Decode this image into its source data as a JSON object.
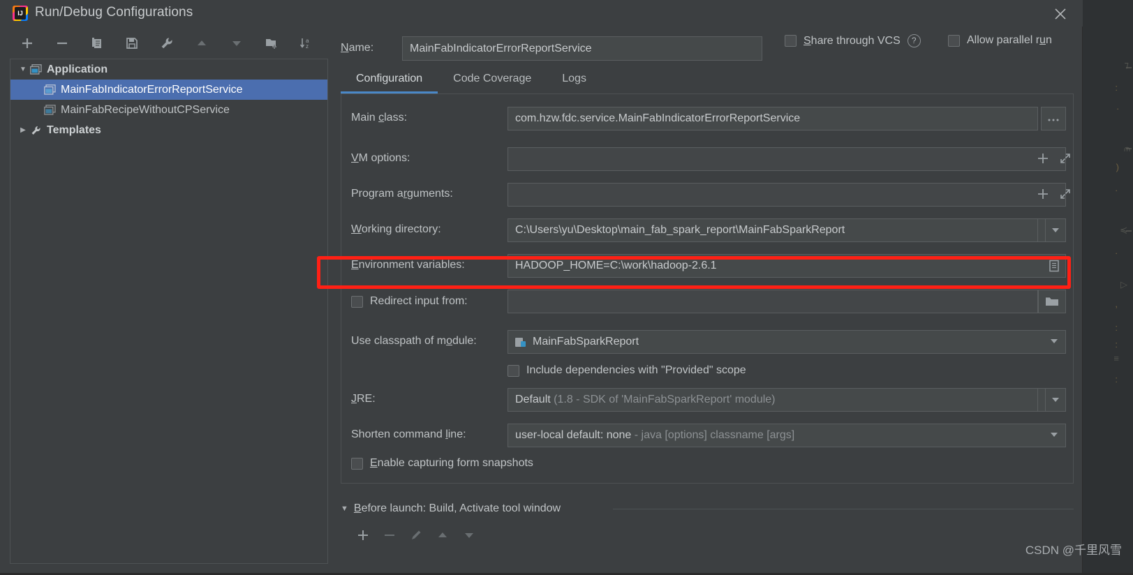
{
  "window": {
    "title": "Run/Debug Configurations",
    "logo_icon": "intellij-idea-logo-icon",
    "close_icon": "close-icon"
  },
  "left_panel": {
    "toolbar": [
      {
        "name": "add-configuration-button",
        "icon": "plus-icon",
        "label": "+",
        "enabled": true
      },
      {
        "name": "remove-configuration-button",
        "icon": "minus-icon",
        "label": "−",
        "enabled": true
      },
      {
        "name": "copy-configuration-button",
        "icon": "copy-icon",
        "label": "Copy",
        "enabled": true
      },
      {
        "name": "save-configuration-button",
        "icon": "save-icon",
        "label": "Save",
        "enabled": true
      },
      {
        "name": "edit-templates-button",
        "icon": "wrench-icon",
        "label": "Edit Templates",
        "enabled": true
      },
      {
        "name": "move-up-button",
        "icon": "arrow-up-icon",
        "label": "Move Up",
        "enabled": false
      },
      {
        "name": "move-down-button",
        "icon": "arrow-down-icon",
        "label": "Move Down",
        "enabled": false
      },
      {
        "name": "new-folder-button",
        "icon": "new-folder-icon",
        "label": "New Folder",
        "enabled": true
      },
      {
        "name": "sort-alphabetically-button",
        "icon": "sort-az-icon",
        "label": "Sort Configurations",
        "enabled": true
      }
    ],
    "tree": [
      {
        "label": "Application",
        "level": 0,
        "expanded": true,
        "icon": "application-icon",
        "selected": false,
        "bold": true
      },
      {
        "label": "MainFabIndicatorErrorReportService",
        "level": 1,
        "expanded": null,
        "icon": "application-icon",
        "selected": true,
        "bold": false
      },
      {
        "label": "MainFabRecipeWithoutCPService",
        "level": 1,
        "expanded": null,
        "icon": "application-icon",
        "selected": false,
        "bold": false
      },
      {
        "label": "Templates",
        "level": 0,
        "expanded": false,
        "icon": "wrench-icon",
        "selected": false,
        "bold": true
      }
    ]
  },
  "header": {
    "name_label": "Name:",
    "name_value": "MainFabIndicatorErrorReportService",
    "share_vcs_label": "Share through VCS",
    "share_vcs_checked": false,
    "help_icon": "help-circle-icon",
    "allow_parallel_label": "Allow parallel run",
    "allow_parallel_checked": false
  },
  "tabs": [
    {
      "label": "Configuration",
      "active": true
    },
    {
      "label": "Code Coverage",
      "active": false
    },
    {
      "label": "Logs",
      "active": false
    }
  ],
  "form": {
    "main_class": {
      "label": "Main class:",
      "value": "com.hzw.fdc.service.MainFabIndicatorErrorReportService",
      "browse_label": "...",
      "browse_icon": "ellipsis-icon"
    },
    "vm_options": {
      "label": "VM options:",
      "value": "",
      "macro_icon": "plus-icon",
      "expand_icon": "expand-icon"
    },
    "program_arguments": {
      "label": "Program arguments:",
      "value": "",
      "macro_icon": "plus-icon",
      "expand_icon": "expand-icon"
    },
    "working_directory": {
      "label": "Working directory:",
      "value": "C:\\Users\\yu\\Desktop\\main_fab_spark_report\\MainFabSparkReport",
      "browse_icon": "folder-icon",
      "dropdown_icon": "chevron-down-icon"
    },
    "environment_variables": {
      "label": "Environment variables:",
      "value": "HADOOP_HOME=C:\\work\\hadoop-2.6.1",
      "browse_icon": "document-list-icon",
      "highlighted": true
    },
    "redirect_input": {
      "label": "Redirect input from:",
      "checked": false,
      "value": "",
      "browse_icon": "folder-icon"
    },
    "use_classpath_of_module": {
      "label": "Use classpath of module:",
      "value": "MainFabSparkReport",
      "item_icon": "module-icon",
      "dropdown_icon": "chevron-down-icon"
    },
    "include_provided": {
      "label": "Include dependencies with \"Provided\" scope",
      "checked": false
    },
    "jre": {
      "label": "JRE:",
      "value": "Default",
      "value_hint": "(1.8 - SDK of 'MainFabSparkReport' module)",
      "browse_icon": "folder-icon",
      "dropdown_icon": "chevron-down-icon"
    },
    "shorten_command_line": {
      "label": "Shorten command line:",
      "value": "user-local default: none",
      "value_hint": "- java [options] classname [args]",
      "dropdown_icon": "chevron-down-icon"
    },
    "enable_capturing_form_snapshots": {
      "label": "Enable capturing form snapshots",
      "checked": false
    }
  },
  "before_launch": {
    "arrow_icon": "chevron-down-icon",
    "title": "Before launch: Build, Activate tool window",
    "toolbar": [
      {
        "name": "add-task-button",
        "icon": "plus-icon",
        "enabled": true
      },
      {
        "name": "remove-task-button",
        "icon": "minus-icon",
        "enabled": false
      },
      {
        "name": "edit-task-button",
        "icon": "pencil-icon",
        "enabled": false
      },
      {
        "name": "move-task-up-button",
        "icon": "arrow-up-icon",
        "enabled": false
      },
      {
        "name": "move-task-down-button",
        "icon": "arrow-down-icon",
        "enabled": false
      }
    ]
  },
  "watermark": {
    "text": "CSDN @千里风雪"
  },
  "colors": {
    "dialog_bg": "#3c3f41",
    "field_bg": "#45494a",
    "selection_blue": "#4b6eaf",
    "tab_accent": "#4a88c7",
    "highlight_red": "#ff2015",
    "text": "#c0c4c6",
    "text_dim": "#8d9194"
  }
}
